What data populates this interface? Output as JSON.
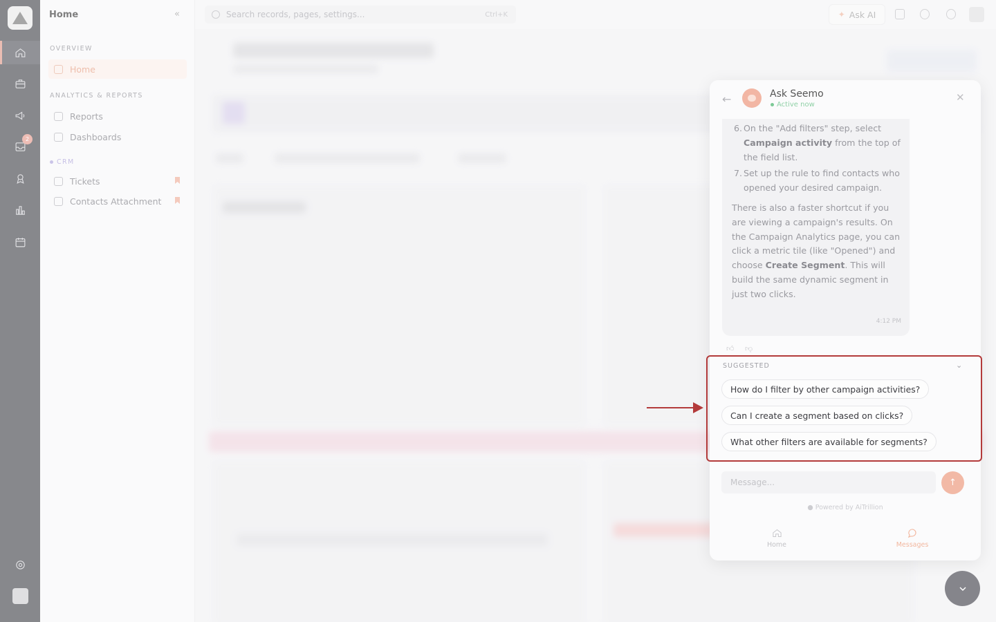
{
  "sidebar": {
    "title": "Home",
    "sections": [
      {
        "label": "OVERVIEW"
      },
      {
        "label": "ANALYTICS & REPORTS"
      },
      {
        "label": "CRM"
      }
    ],
    "items": [
      {
        "label": "Home"
      },
      {
        "label": "Reports"
      },
      {
        "label": "Dashboards"
      },
      {
        "label": "Tickets"
      },
      {
        "label": "Contacts Attachment"
      }
    ]
  },
  "rail": {
    "badge_count": "2"
  },
  "topbar": {
    "search_placeholder": "Search records, pages, settings...",
    "search_shortcut": "Ctrl+K",
    "ask_ai_label": "Ask AI"
  },
  "chat": {
    "bot_name": "Ask Seemo",
    "status": "Active now",
    "message": {
      "steps": [
        {
          "num": "6.",
          "pre": "On the \"Add filters\" step, select ",
          "bold": "Campaign activity",
          "post": " from the top of the field list."
        },
        {
          "num": "7.",
          "pre": "Set up the rule to find contacts who opened your desired campaign.",
          "bold": "",
          "post": ""
        }
      ],
      "para_pre": "There is also a faster shortcut if you are viewing a campaign's results. On the Campaign Analytics page, you can click a metric tile (like \"Opened\") and choose ",
      "para_bold": "Create Segment",
      "para_post": ". This will build the same dynamic segment in just two clicks.",
      "time": "4:12 PM"
    },
    "suggested_title": "SUGGESTED",
    "suggestions": [
      "How do I filter by other campaign activities?",
      "Can I create a segment based on clicks?",
      "What other filters are available for segments?"
    ],
    "input_placeholder": "Message...",
    "powered_by": "Powered by AiTrillion",
    "nav": {
      "home": "Home",
      "messages": "Messages"
    }
  },
  "colors": {
    "accent": "#f2b9a6",
    "highlight": "#b33a3a",
    "rail": "#5f6066"
  }
}
